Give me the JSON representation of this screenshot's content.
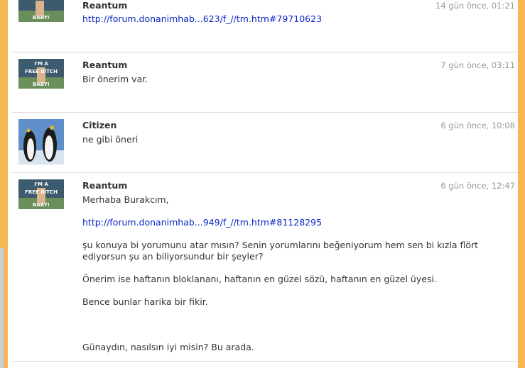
{
  "feed": {
    "entries": [
      {
        "author": "Reantum",
        "time": "14 gün önce, 01:21",
        "avatar": "free-bitch-baby-avatar",
        "link": "http://forum.donanimhab...623/f_//tm.htm#79710623"
      },
      {
        "author": "Reantum",
        "time": "7 gün önce, 03:11",
        "avatar": "free-bitch-baby-avatar",
        "text": "Bir önerim var."
      },
      {
        "author": "Citizen",
        "time": "6 gün önce, 10:08",
        "avatar": "penguins-avatar",
        "text": "ne gibi öneri"
      },
      {
        "author": "Reantum",
        "time": "6 gün önce, 12:47",
        "avatar": "free-bitch-baby-avatar",
        "greeting": "Merhaba Burakcım,",
        "link": "http://forum.donanimhab...949/f_//tm.htm#81128295",
        "para1": "şu konuya bi yorumunu atar mısın? Senin yorumlarını beğeniyorum hem sen bi kızla flört ediyorsun şu an biliyorsundur bir şeyler?",
        "para2": "Önerim ise haftanın bloklananı, haftanın en güzel sözü, haftanın en güzel üyesi.",
        "para3": "Bence bunlar harika bir fikir.",
        "para4": "Günaydın, nasılsın iyi misin? Bu arada."
      }
    ]
  },
  "avatar_text": {
    "line1": "I'M A",
    "line2": "FREE BITCH",
    "line3": "BABY!"
  },
  "colors": {
    "frame": "#f7b750",
    "link": "#0b26c4",
    "timestamp": "#999999",
    "divider": "#dcdcdc"
  }
}
